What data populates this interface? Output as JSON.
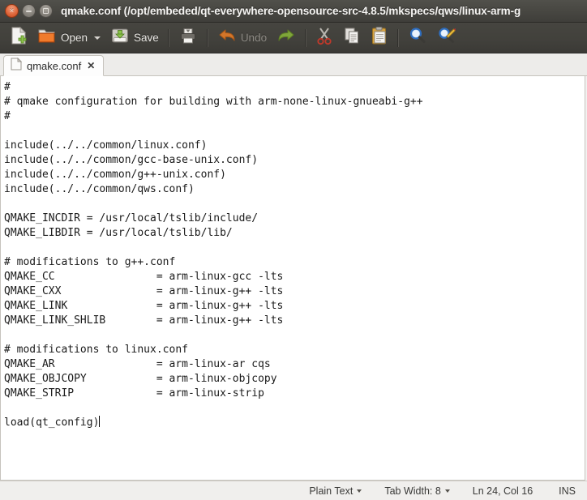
{
  "window": {
    "title": "qmake.conf (/opt/embeded/qt-everywhere-opensource-src-4.8.5/mkspecs/qws/linux-arm-g",
    "controls": {
      "close": "×",
      "minimize": "",
      "maximize": ""
    }
  },
  "toolbar": {
    "new_label": "",
    "open_label": "Open",
    "save_label": "Save",
    "print_label": "",
    "undo_label": "Undo",
    "redo_label": "",
    "cut_label": "",
    "copy_label": "",
    "paste_label": "",
    "find_label": "",
    "replace_label": ""
  },
  "tabs": [
    {
      "title": "qmake.conf",
      "close": "✕"
    }
  ],
  "editor": {
    "content": "#\n# qmake configuration for building with arm-none-linux-gnueabi-g++\n#\n\ninclude(../../common/linux.conf)\ninclude(../../common/gcc-base-unix.conf)\ninclude(../../common/g++-unix.conf)\ninclude(../../common/qws.conf)\n\nQMAKE_INCDIR = /usr/local/tslib/include/\nQMAKE_LIBDIR = /usr/local/tslib/lib/\n\n# modifications to g++.conf\nQMAKE_CC                = arm-linux-gcc -lts\nQMAKE_CXX               = arm-linux-g++ -lts\nQMAKE_LINK              = arm-linux-g++ -lts\nQMAKE_LINK_SHLIB        = arm-linux-g++ -lts\n\n# modifications to linux.conf\nQMAKE_AR                = arm-linux-ar cqs\nQMAKE_OBJCOPY           = arm-linux-objcopy\nQMAKE_STRIP             = arm-linux-strip\n\nload(qt_config)"
  },
  "statusbar": {
    "language": "Plain Text",
    "tab_width": "Tab Width: 8",
    "cursor_position": "Ln 24, Col 16",
    "insert_mode": "INS"
  },
  "colors": {
    "titlebar": "#484742",
    "toolbar": "#42413c",
    "close_button": "#e0683c",
    "editor_background": "#ffffff",
    "statusbar": "#f0efed",
    "text": "#1a1a1a"
  }
}
